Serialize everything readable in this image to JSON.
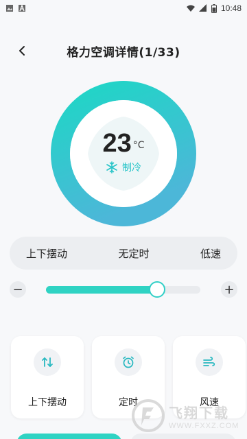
{
  "status_bar": {
    "time": "10:48",
    "left_icons": [
      "image-icon",
      "a-notification-icon"
    ],
    "right_icons": [
      "wifi-icon",
      "signal-icon",
      "battery-icon"
    ]
  },
  "header": {
    "title": "格力空调详情(1/33)",
    "back_icon": "chevron-left-icon"
  },
  "dial": {
    "temperature": "23",
    "unit": "°C",
    "mode": "制冷",
    "mode_icon": "snowflake-icon",
    "ring_colors": [
      "#1fd6c6",
      "#4cb7d8"
    ]
  },
  "settings": {
    "swing": "上下摆动",
    "timer": "无定时",
    "fan_speed": "低速"
  },
  "slider": {
    "minus_label": "−",
    "plus_label": "+",
    "value_fraction": 0.72
  },
  "functions": [
    {
      "label": "上下摆动",
      "icon": "swing-arrows-icon"
    },
    {
      "label": "定时",
      "icon": "alarm-clock-icon"
    },
    {
      "label": "风速",
      "icon": "wind-icon"
    }
  ],
  "watermark": {
    "big": "飞翔下载",
    "small": "WWW.FXXZ.COM"
  },
  "colors": {
    "accent": "#2fd3c3",
    "accent_text": "#27c4c8",
    "pill_bg": "#eceef1",
    "page_bg": "#f7f8fa"
  }
}
